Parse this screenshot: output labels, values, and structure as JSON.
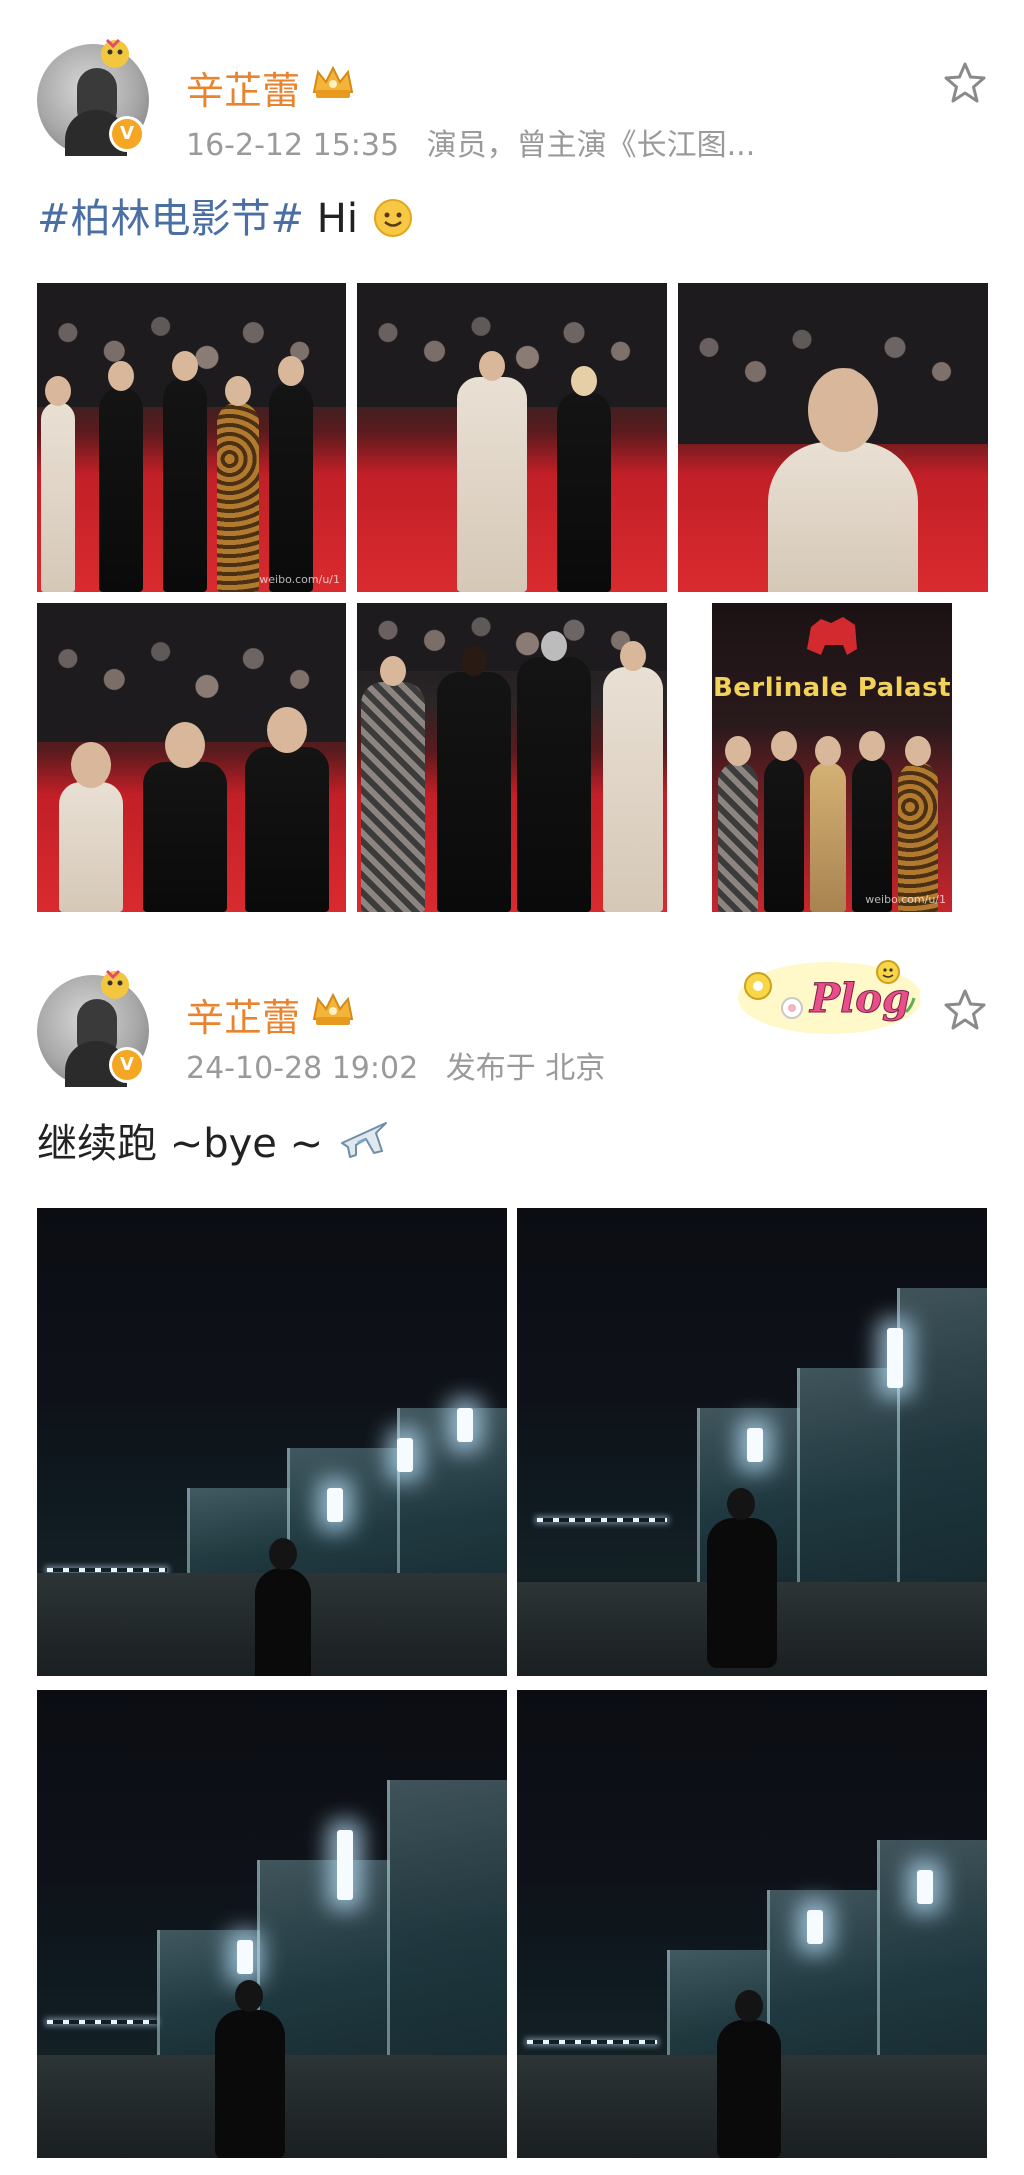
{
  "feed": {
    "posts": [
      {
        "username": "辛芷蕾",
        "timestamp": "16-2-12 15:35",
        "source": "演员，曾主演《长江图...",
        "text": {
          "hashtag": "#柏林电影节#",
          "body": " Hi ",
          "emoji_icon": "smile-emoji-icon"
        },
        "images": [
          {
            "watermark": "weibo.com/u/1"
          },
          {
            "watermark": ""
          },
          {
            "watermark": ""
          },
          {
            "watermark": ""
          },
          {
            "watermark": ""
          },
          {
            "banner": "Berlinale Palast",
            "watermark": "weibo.com/u/1"
          }
        ]
      },
      {
        "username": "辛芷蕾",
        "timestamp": "24-10-28 19:02",
        "source": "发布于 北京",
        "sticker_text": "Plog",
        "text": {
          "body": "继续跑 ~bye ~ ",
          "emoji_icon": "airplane-emoji-icon"
        },
        "images": [
          {},
          {},
          {},
          {}
        ]
      }
    ]
  },
  "colors": {
    "username": "#e8832f",
    "meta": "#9a9a9a",
    "hashtag": "#4a6fa5",
    "verified_badge": "#f5a623"
  },
  "icons": {
    "favorite": "star-outline-icon",
    "membership": "crown-badge-icon",
    "verified": "verified-v-icon"
  }
}
